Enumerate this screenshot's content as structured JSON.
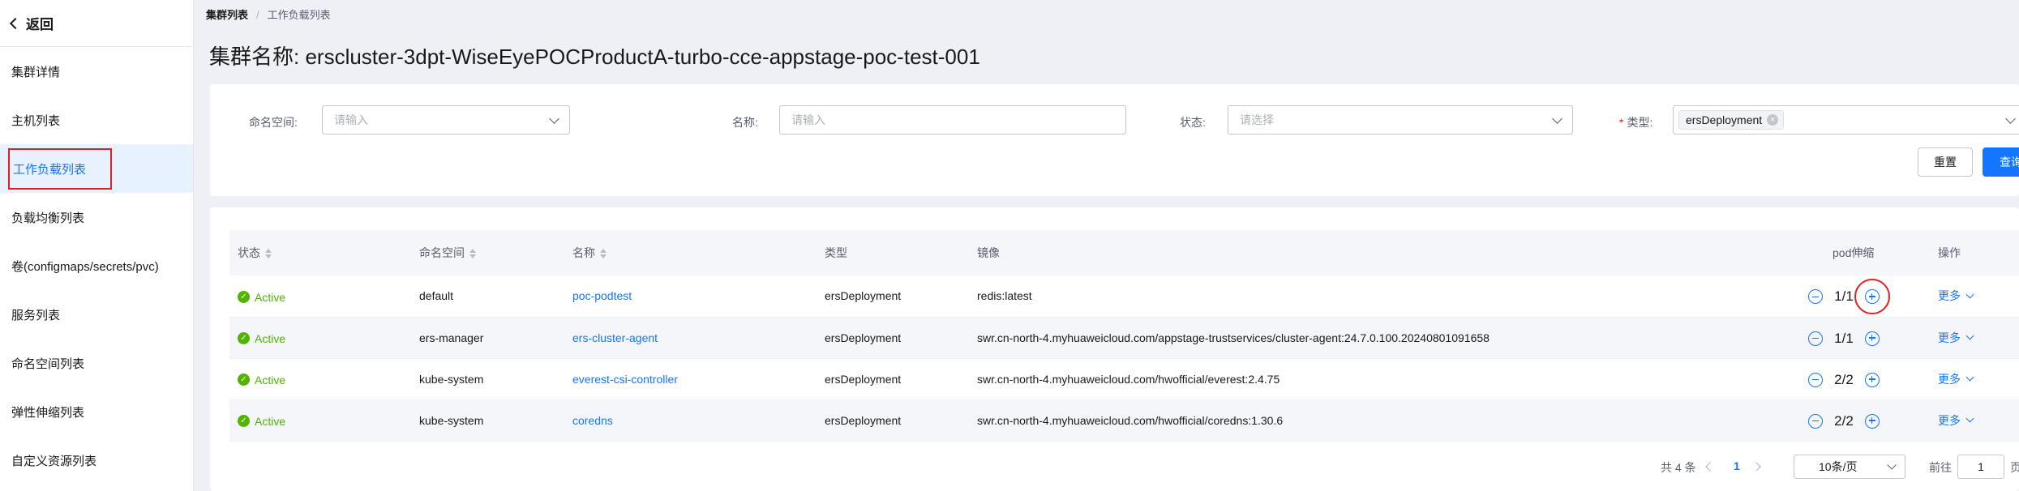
{
  "sidebar": {
    "back_label": "返回",
    "items": [
      {
        "label": "集群详情"
      },
      {
        "label": "主机列表"
      },
      {
        "label": "工作负载列表"
      },
      {
        "label": "负载均衡列表"
      },
      {
        "label": "卷(configmaps/secrets/pvc)"
      },
      {
        "label": "服务列表"
      },
      {
        "label": "命名空间列表"
      },
      {
        "label": "弹性伸缩列表"
      },
      {
        "label": "自定义资源列表"
      }
    ]
  },
  "breadcrumb": {
    "root": "集群列表",
    "separator": "/",
    "current": "工作负载列表"
  },
  "title": "集群名称: erscluster-3dpt-WiseEyePOCProductA-turbo-cce-appstage-poc-test-001",
  "filters": {
    "namespace": {
      "label": "命名空间:",
      "placeholder": "请输入"
    },
    "name": {
      "label": "名称:",
      "placeholder": "请输入"
    },
    "status": {
      "label": "状态:",
      "placeholder": "请选择"
    },
    "type": {
      "required_mark": "*",
      "label": "类型:",
      "selected_tag": "ersDeployment"
    },
    "reset_label": "重置",
    "query_label": "查询"
  },
  "table": {
    "headers": {
      "status": "状态",
      "namespace": "命名空间",
      "name": "名称",
      "type": "类型",
      "image": "镜像",
      "pod": "pod伸缩",
      "action": "操作"
    },
    "rows": [
      {
        "status": "Active",
        "namespace": "default",
        "name": "poc-podtest",
        "type": "ersDeployment",
        "image": "redis:latest",
        "pods": "1/1",
        "more": "更多"
      },
      {
        "status": "Active",
        "namespace": "ers-manager",
        "name": "ers-cluster-agent",
        "type": "ersDeployment",
        "image": "swr.cn-north-4.myhuaweicloud.com/appstage-trustservices/cluster-agent:24.7.0.100.20240801091658",
        "pods": "1/1",
        "more": "更多"
      },
      {
        "status": "Active",
        "namespace": "kube-system",
        "name": "everest-csi-controller",
        "type": "ersDeployment",
        "image": "swr.cn-north-4.myhuaweicloud.com/hwofficial/everest:2.4.75",
        "pods": "2/2",
        "more": "更多"
      },
      {
        "status": "Active",
        "namespace": "kube-system",
        "name": "coredns",
        "type": "ersDeployment",
        "image": "swr.cn-north-4.myhuaweicloud.com/hwofficial/coredns:1.30.6",
        "pods": "2/2",
        "more": "更多"
      }
    ]
  },
  "pagination": {
    "total": "共 4 条",
    "current_page": "1",
    "page_size": "10条/页",
    "goto_label": "前往",
    "goto_value": "1",
    "page_suffix": "页"
  },
  "colors": {
    "accent": "#1476ff",
    "active": "#50b400",
    "highlight": "#e02020"
  }
}
